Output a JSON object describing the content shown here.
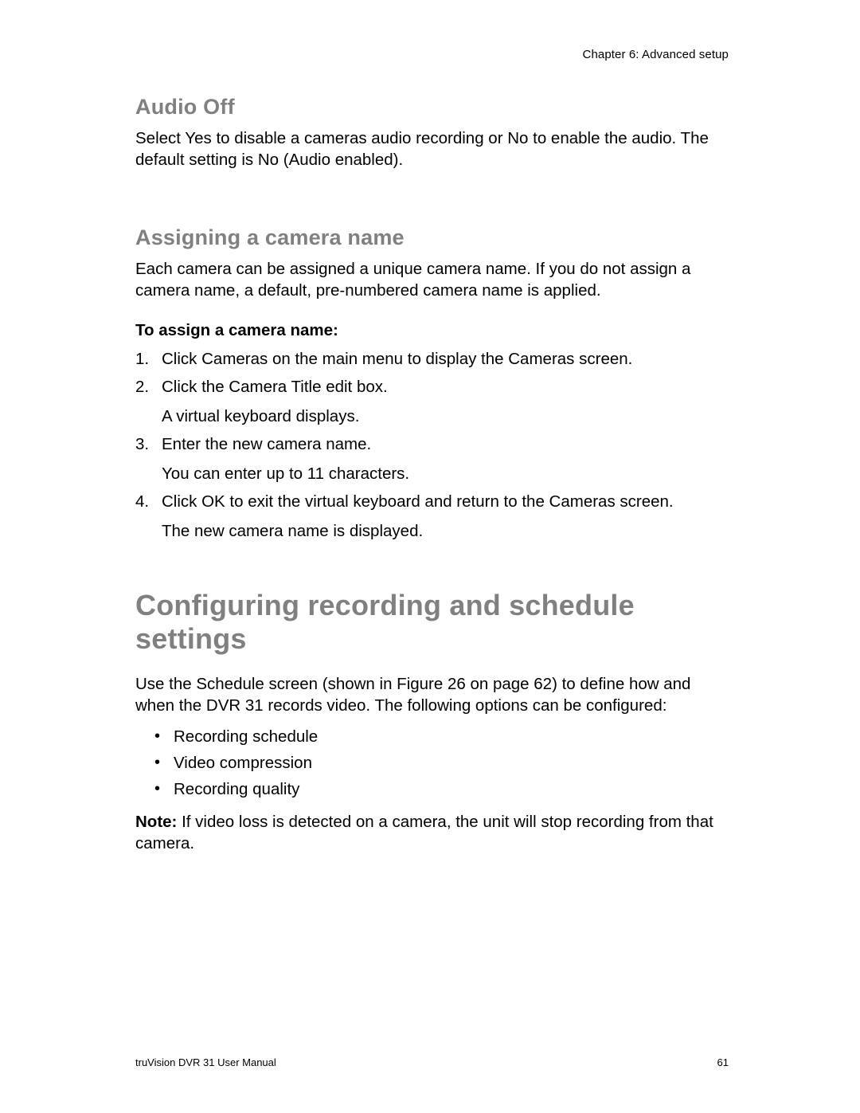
{
  "header": {
    "chapter": "Chapter 6: Advanced setup"
  },
  "sections": {
    "audio_off": {
      "title": "Audio Off",
      "body": "Select Yes to disable a cameras audio recording or No to enable the audio. The default setting is No (Audio enabled)."
    },
    "assigning": {
      "title": "Assigning a camera name",
      "intro": "Each camera can be assigned a unique camera name. If you do not assign a camera name, a default, pre-numbered camera name is applied.",
      "procedure_label": "To assign a camera name:",
      "steps": [
        {
          "text": "Click Cameras on the main menu to display the Cameras screen."
        },
        {
          "text": "Click the Camera Title edit box.",
          "sub": "A virtual keyboard displays."
        },
        {
          "text": "Enter the new camera name.",
          "sub": "You can enter up to 11 characters."
        },
        {
          "text": "Click OK to exit the virtual keyboard and return to the Cameras screen.",
          "sub": "The new camera name is displayed."
        }
      ]
    },
    "configuring": {
      "title": "Configuring recording and schedule settings",
      "intro": "Use the Schedule screen (shown in Figure 26 on page 62) to define how and when the DVR 31 records video. The following options can be configured:",
      "bullets": [
        "Recording schedule",
        "Video compression",
        "Recording quality"
      ],
      "note_label": "Note:",
      "note_body": " If video loss is detected on a camera, the unit will stop recording from that camera."
    }
  },
  "footer": {
    "manual": "truVision DVR 31 User Manual",
    "page": "61"
  }
}
